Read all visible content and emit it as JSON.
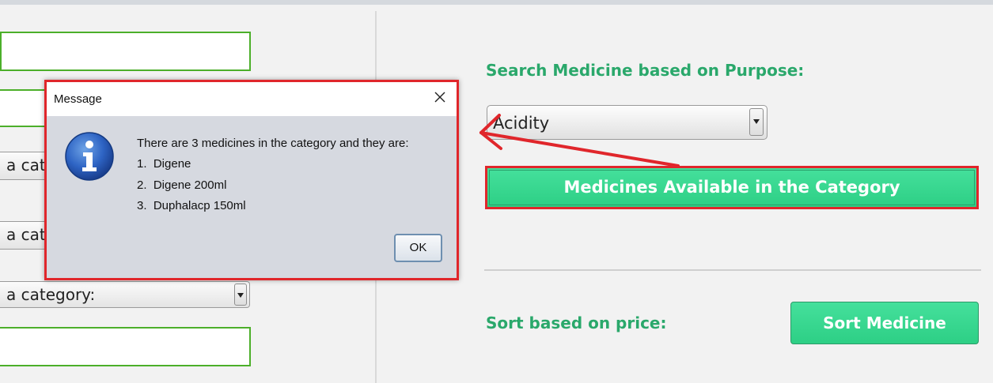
{
  "left_form": {
    "combo_1": "a cat",
    "combo_2": "a cat",
    "combo_3": "a category:"
  },
  "right_panel": {
    "purpose_heading": "Search Medicine based on Purpose:",
    "purpose_selected": "Acidity",
    "available_button": "Medicines Available in the Category",
    "sort_heading": "Sort based on price:",
    "sort_button": "Sort Medicine"
  },
  "dialog": {
    "title": "Message",
    "message": "There are 3 medicines in the category and they are:",
    "items": [
      "1.  Digene",
      "2.  Digene 200ml",
      "3.  Duphalacp 150ml"
    ],
    "ok_label": "OK"
  },
  "colors": {
    "accent_green": "#2aa86b",
    "button_green": "#3bd891",
    "field_border_green": "#4caf2a",
    "highlight_red": "#e0262b"
  },
  "icons": [
    "info-icon",
    "close-icon",
    "chevron-down-icon",
    "arrow-annotation"
  ]
}
